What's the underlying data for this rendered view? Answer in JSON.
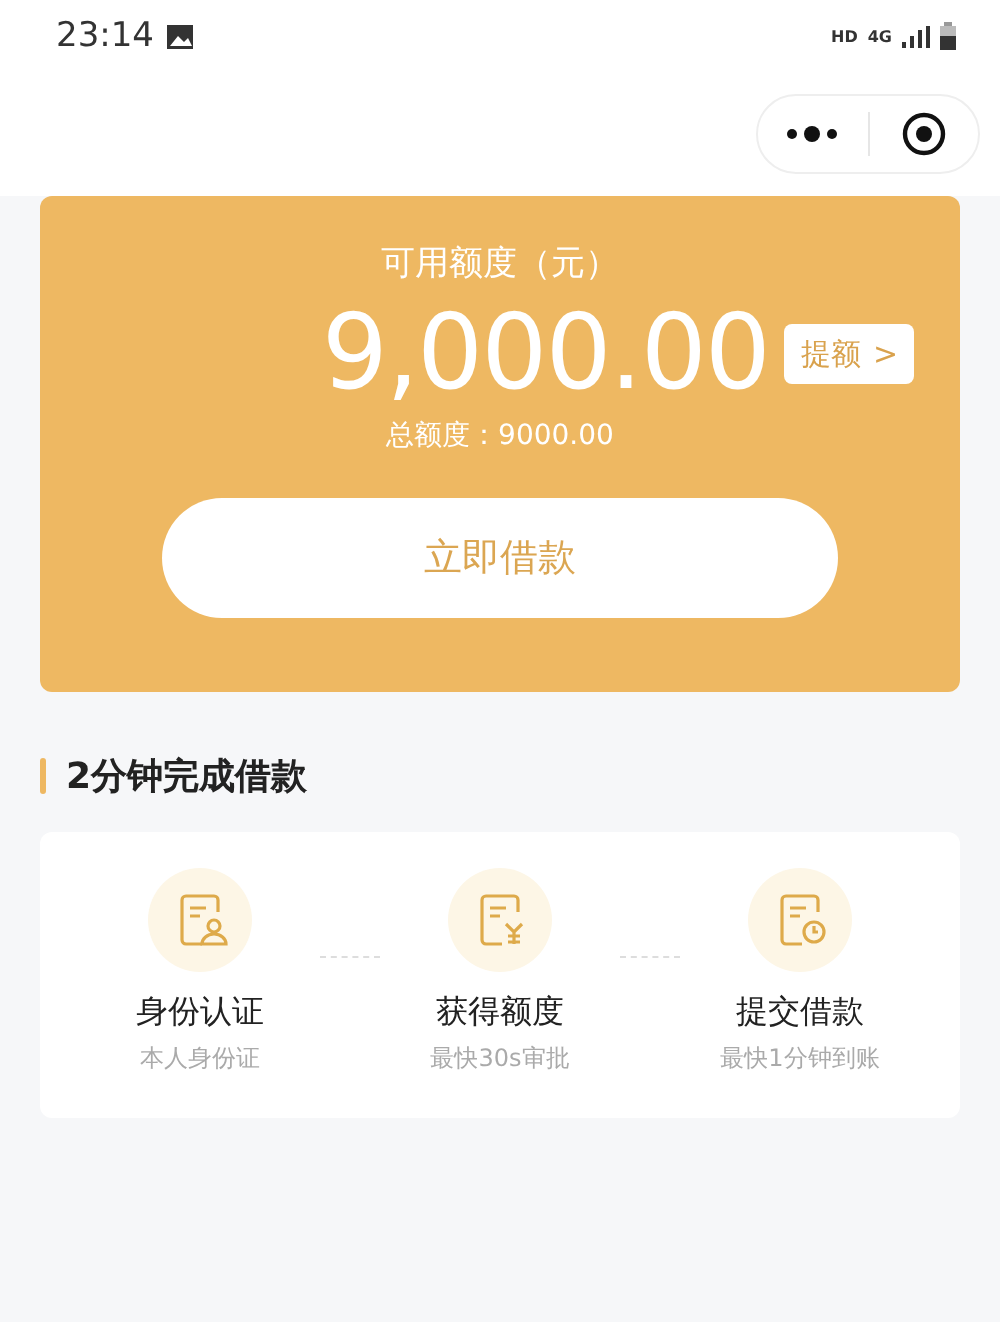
{
  "status_bar": {
    "time": "23:14",
    "network": "4G",
    "hd": "HD"
  },
  "quota_card": {
    "title": "可用额度（元）",
    "amount": "9,000.00",
    "raise_button": "提额",
    "raise_arrow": ">",
    "total": "总额度：9000.00",
    "borrow_button": "立即借款"
  },
  "steps_section": {
    "heading": "2分钟完成借款",
    "steps": [
      {
        "kind": "identity",
        "title": "身份认证",
        "subtitle": "本人身份证"
      },
      {
        "kind": "quota",
        "title": "获得额度",
        "subtitle": "最快30s审批"
      },
      {
        "kind": "submit",
        "title": "提交借款",
        "subtitle": "最快1分钟到账"
      }
    ]
  }
}
